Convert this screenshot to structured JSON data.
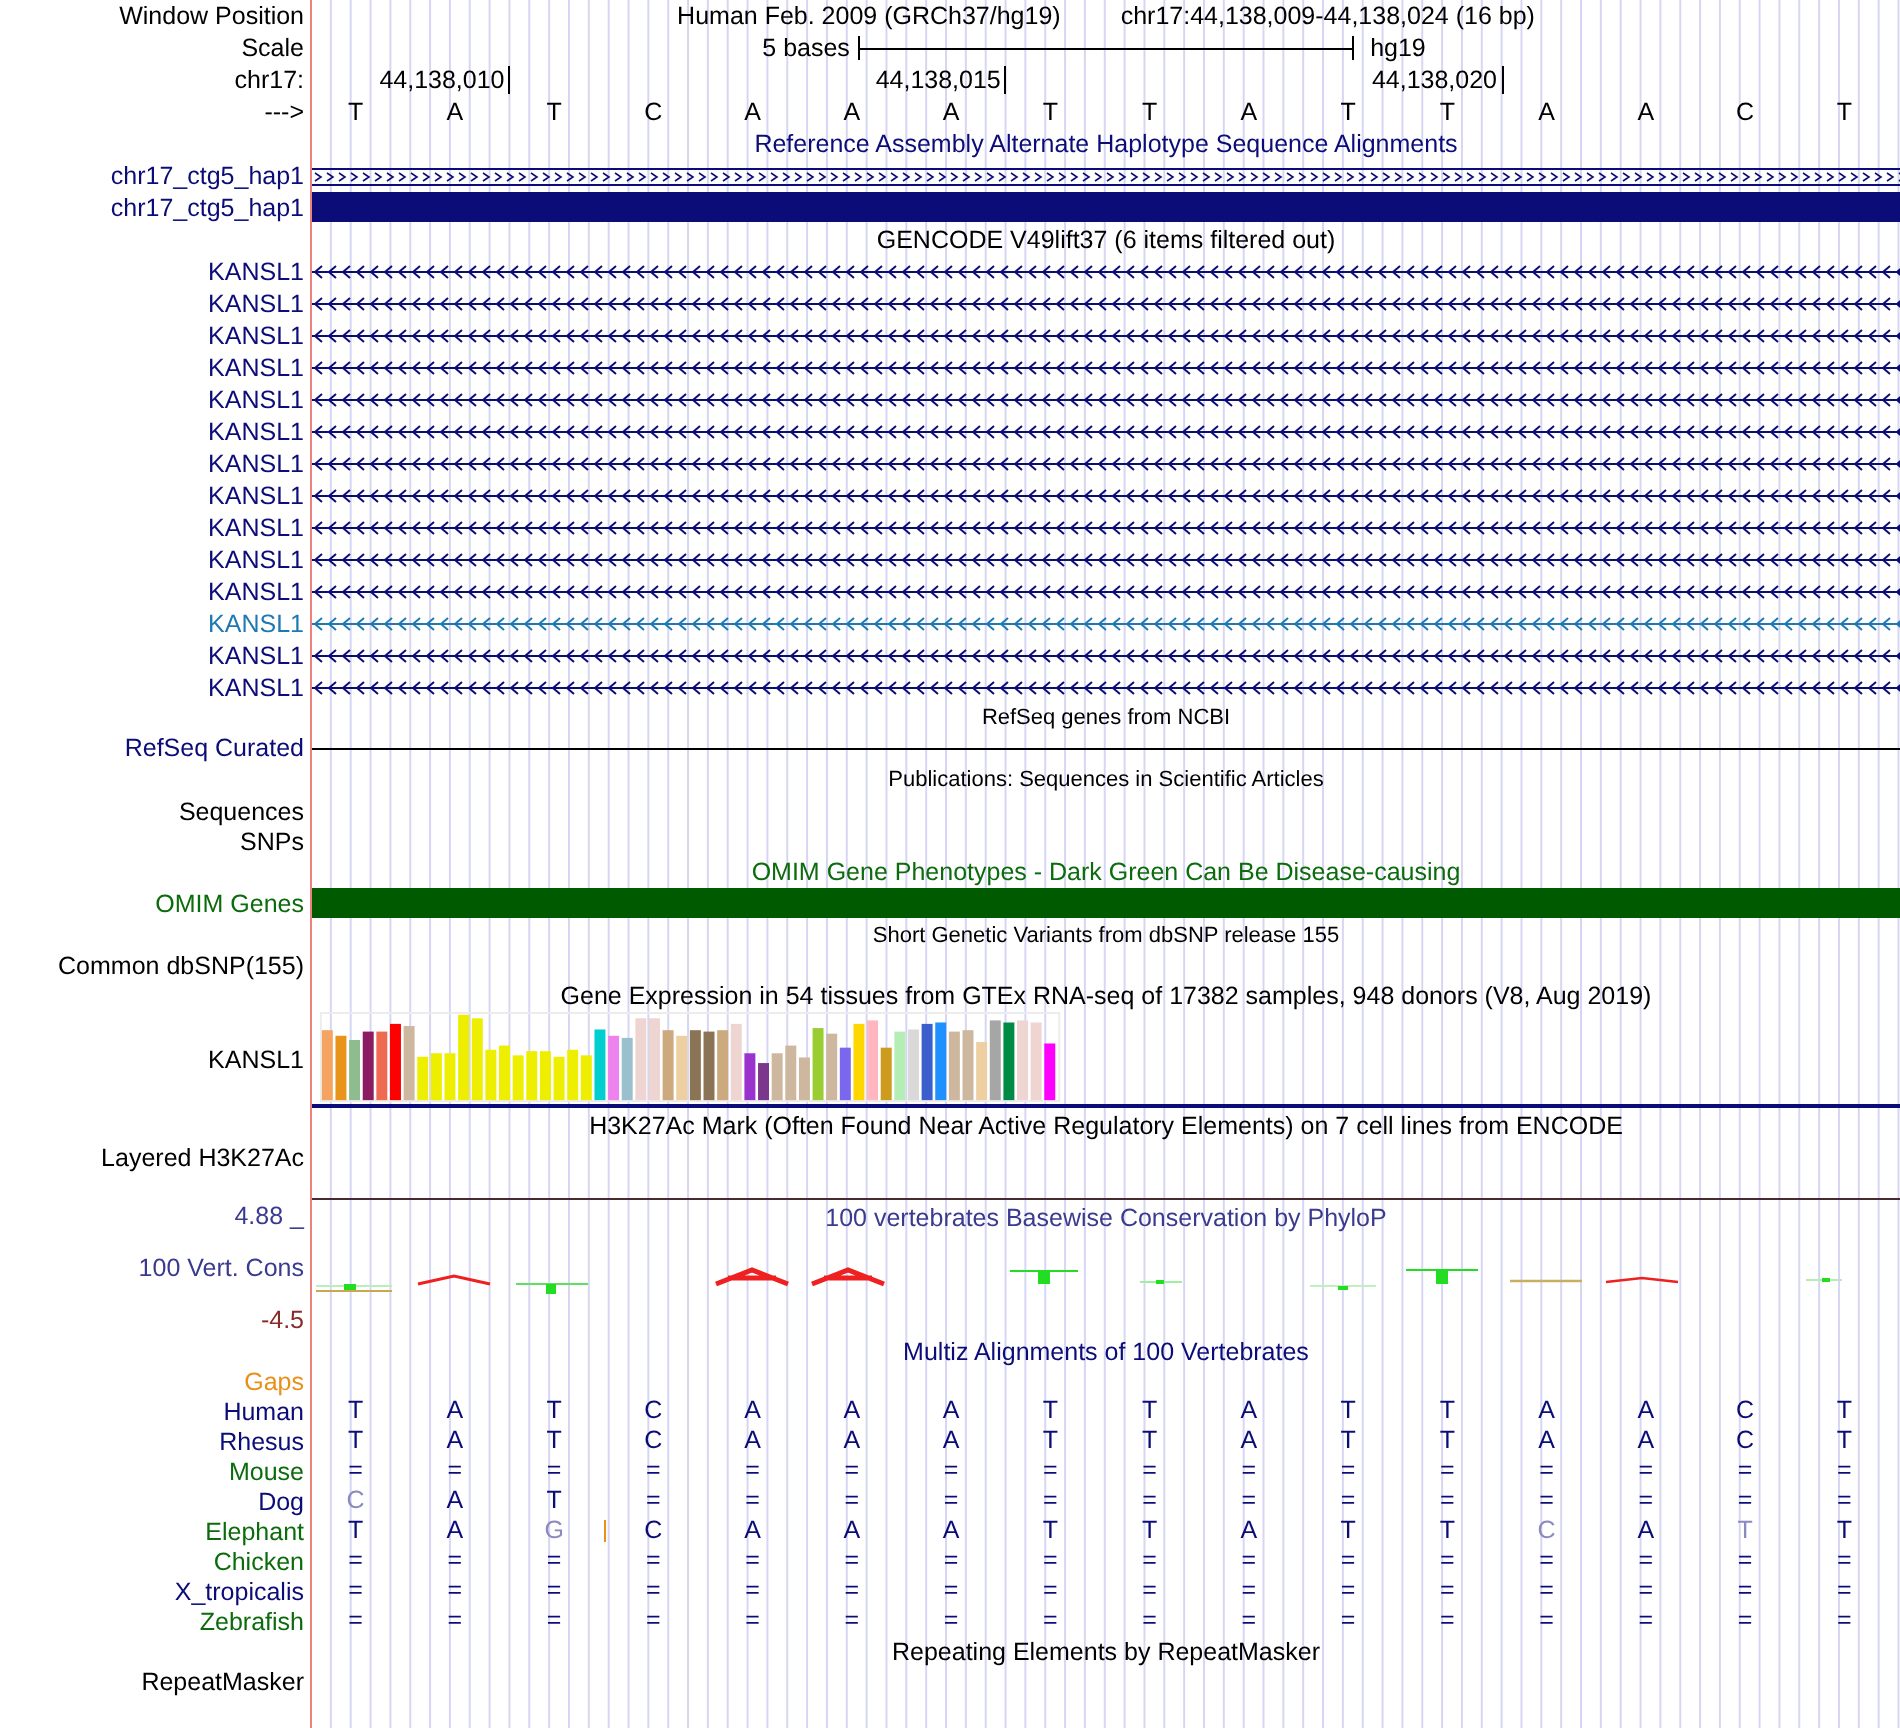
{
  "header": {
    "label": "Window Position",
    "assembly": "Human Feb. 2009 (GRCh37/hg19)",
    "range": "chr17:44,138,009-44,138,024 (16 bp)"
  },
  "scale": {
    "label": "Scale",
    "span": "5 bases",
    "db": "hg19"
  },
  "ruler": {
    "label": "chr17:",
    "ticks": [
      "44,138,010",
      "44,138,015",
      "44,138,020"
    ],
    "strand": "--->",
    "bases": [
      "T",
      "A",
      "T",
      "C",
      "A",
      "A",
      "A",
      "T",
      "T",
      "A",
      "T",
      "T",
      "A",
      "A",
      "C",
      "T"
    ]
  },
  "alt_haplotypes": {
    "title": "Reference Assembly Alternate Haplotype Sequence Alignments",
    "items": [
      {
        "label": "chr17_ctg5_hap1",
        "kind": "chevrons"
      },
      {
        "label": "chr17_ctg5_hap1",
        "kind": "solid"
      }
    ]
  },
  "gencode": {
    "title": "GENCODE V49lift37 (6 items filtered out)",
    "genes": [
      {
        "name": "KANSL1",
        "color": "#0c0c78"
      },
      {
        "name": "KANSL1",
        "color": "#0c0c78"
      },
      {
        "name": "KANSL1",
        "color": "#0c0c78"
      },
      {
        "name": "KANSL1",
        "color": "#0c0c78"
      },
      {
        "name": "KANSL1",
        "color": "#0c0c78"
      },
      {
        "name": "KANSL1",
        "color": "#0c0c78"
      },
      {
        "name": "KANSL1",
        "color": "#0c0c78"
      },
      {
        "name": "KANSL1",
        "color": "#0c0c78"
      },
      {
        "name": "KANSL1",
        "color": "#0c0c78"
      },
      {
        "name": "KANSL1",
        "color": "#0c0c78"
      },
      {
        "name": "KANSL1",
        "color": "#0c0c78"
      },
      {
        "name": "KANSL1",
        "color": "#1f78b4"
      },
      {
        "name": "KANSL1",
        "color": "#0c0c78"
      },
      {
        "name": "KANSL1",
        "color": "#0c0c78"
      }
    ]
  },
  "refseq": {
    "title": "RefSeq genes from NCBI",
    "label": "RefSeq Curated"
  },
  "publications": {
    "title": "Publications: Sequences in Scientific Articles",
    "labels": [
      "Sequences",
      "SNPs"
    ]
  },
  "omim": {
    "title": "OMIM Gene Phenotypes - Dark Green Can Be Disease-causing",
    "label": "OMIM Genes"
  },
  "dbsnp": {
    "title": "Short Genetic Variants from dbSNP release 155",
    "label": "Common dbSNP(155)"
  },
  "gtex": {
    "title": "Gene Expression in 54 tissues from GTEx RNA-seq of 17382 samples, 948 donors (V8, Aug 2019)",
    "label": "KANSL1"
  },
  "h3k27ac": {
    "title": "H3K27Ac Mark (Often Found Near Active Regulatory Elements) on 7 cell lines from ENCODE",
    "label": "Layered H3K27Ac"
  },
  "conservation": {
    "title": "100 vertebrates Basewise Conservation by PhyloP",
    "label": "100 Vert. Cons",
    "max": "4.88 _",
    "min": "-4.5"
  },
  "multiz": {
    "title": "Multiz Alignments of 100 Vertebrates",
    "gaps_label": "Gaps",
    "species": [
      {
        "name": "Human",
        "color": "#0c0c78",
        "bases": [
          {
            "b": "T",
            "faded": false,
            "gap_after": false
          },
          {
            "b": "A",
            "faded": false,
            "gap_after": false
          },
          {
            "b": "T",
            "faded": false,
            "gap_after": false
          },
          {
            "b": "C",
            "faded": false,
            "gap_after": false
          },
          {
            "b": "A",
            "faded": false,
            "gap_after": false
          },
          {
            "b": "A",
            "faded": false,
            "gap_after": false
          },
          {
            "b": "A",
            "faded": false,
            "gap_after": false
          },
          {
            "b": "T",
            "faded": false,
            "gap_after": false
          },
          {
            "b": "T",
            "faded": false,
            "gap_after": false
          },
          {
            "b": "A",
            "faded": false,
            "gap_after": false
          },
          {
            "b": "T",
            "faded": false,
            "gap_after": false
          },
          {
            "b": "T",
            "faded": false,
            "gap_after": false
          },
          {
            "b": "A",
            "faded": false,
            "gap_after": false
          },
          {
            "b": "A",
            "faded": false,
            "gap_after": false
          },
          {
            "b": "C",
            "faded": false,
            "gap_after": false
          },
          {
            "b": "T",
            "faded": false,
            "gap_after": false
          }
        ]
      },
      {
        "name": "Rhesus",
        "color": "#0c0c78",
        "bases": [
          {
            "b": "T",
            "faded": false,
            "gap_after": false
          },
          {
            "b": "A",
            "faded": false,
            "gap_after": false
          },
          {
            "b": "T",
            "faded": false,
            "gap_after": false
          },
          {
            "b": "C",
            "faded": false,
            "gap_after": false
          },
          {
            "b": "A",
            "faded": false,
            "gap_after": false
          },
          {
            "b": "A",
            "faded": false,
            "gap_after": false
          },
          {
            "b": "A",
            "faded": false,
            "gap_after": false
          },
          {
            "b": "T",
            "faded": false,
            "gap_after": false
          },
          {
            "b": "T",
            "faded": false,
            "gap_after": false
          },
          {
            "b": "A",
            "faded": false,
            "gap_after": false
          },
          {
            "b": "T",
            "faded": false,
            "gap_after": false
          },
          {
            "b": "T",
            "faded": false,
            "gap_after": false
          },
          {
            "b": "A",
            "faded": false,
            "gap_after": false
          },
          {
            "b": "A",
            "faded": false,
            "gap_after": false
          },
          {
            "b": "C",
            "faded": false,
            "gap_after": false
          },
          {
            "b": "T",
            "faded": false,
            "gap_after": false
          }
        ]
      },
      {
        "name": "Mouse",
        "color": "#0c6b0c",
        "bases": [
          {
            "b": "=",
            "faded": false,
            "gap_after": false
          },
          {
            "b": "=",
            "faded": false,
            "gap_after": false
          },
          {
            "b": "=",
            "faded": false,
            "gap_after": false
          },
          {
            "b": "=",
            "faded": false,
            "gap_after": false
          },
          {
            "b": "=",
            "faded": false,
            "gap_after": false
          },
          {
            "b": "=",
            "faded": false,
            "gap_after": false
          },
          {
            "b": "=",
            "faded": false,
            "gap_after": false
          },
          {
            "b": "=",
            "faded": false,
            "gap_after": false
          },
          {
            "b": "=",
            "faded": false,
            "gap_after": false
          },
          {
            "b": "=",
            "faded": false,
            "gap_after": false
          },
          {
            "b": "=",
            "faded": false,
            "gap_after": false
          },
          {
            "b": "=",
            "faded": false,
            "gap_after": false
          },
          {
            "b": "=",
            "faded": false,
            "gap_after": false
          },
          {
            "b": "=",
            "faded": false,
            "gap_after": false
          },
          {
            "b": "=",
            "faded": false,
            "gap_after": false
          },
          {
            "b": "=",
            "faded": false,
            "gap_after": false
          }
        ]
      },
      {
        "name": "Dog",
        "color": "#0c0c78",
        "bases": [
          {
            "b": "C",
            "faded": true,
            "gap_after": false
          },
          {
            "b": "A",
            "faded": false,
            "gap_after": false
          },
          {
            "b": "T",
            "faded": false,
            "gap_after": false
          },
          {
            "b": "=",
            "faded": false,
            "gap_after": false
          },
          {
            "b": "=",
            "faded": false,
            "gap_after": false
          },
          {
            "b": "=",
            "faded": false,
            "gap_after": false
          },
          {
            "b": "=",
            "faded": false,
            "gap_after": false
          },
          {
            "b": "=",
            "faded": false,
            "gap_after": false
          },
          {
            "b": "=",
            "faded": false,
            "gap_after": false
          },
          {
            "b": "=",
            "faded": false,
            "gap_after": false
          },
          {
            "b": "=",
            "faded": false,
            "gap_after": false
          },
          {
            "b": "=",
            "faded": false,
            "gap_after": false
          },
          {
            "b": "=",
            "faded": false,
            "gap_after": false
          },
          {
            "b": "=",
            "faded": false,
            "gap_after": false
          },
          {
            "b": "=",
            "faded": false,
            "gap_after": false
          },
          {
            "b": "=",
            "faded": false,
            "gap_after": false
          }
        ]
      },
      {
        "name": "Elephant",
        "color": "#0c6b0c",
        "bases": [
          {
            "b": "T",
            "faded": false,
            "gap_after": false
          },
          {
            "b": "A",
            "faded": false,
            "gap_after": false
          },
          {
            "b": "G",
            "faded": true,
            "gap_after": true
          },
          {
            "b": "C",
            "faded": false,
            "gap_after": false
          },
          {
            "b": "A",
            "faded": false,
            "gap_after": false
          },
          {
            "b": "A",
            "faded": false,
            "gap_after": false
          },
          {
            "b": "A",
            "faded": false,
            "gap_after": false
          },
          {
            "b": "T",
            "faded": false,
            "gap_after": false
          },
          {
            "b": "T",
            "faded": false,
            "gap_after": false
          },
          {
            "b": "A",
            "faded": false,
            "gap_after": false
          },
          {
            "b": "T",
            "faded": false,
            "gap_after": false
          },
          {
            "b": "T",
            "faded": false,
            "gap_after": false
          },
          {
            "b": "C",
            "faded": true,
            "gap_after": false
          },
          {
            "b": "A",
            "faded": false,
            "gap_after": false
          },
          {
            "b": "T",
            "faded": true,
            "gap_after": false
          },
          {
            "b": "T",
            "faded": false,
            "gap_after": false
          }
        ]
      },
      {
        "name": "Chicken",
        "color": "#0c6b0c",
        "bases": [
          {
            "b": "=",
            "faded": false,
            "gap_after": false
          },
          {
            "b": "=",
            "faded": false,
            "gap_after": false
          },
          {
            "b": "=",
            "faded": false,
            "gap_after": false
          },
          {
            "b": "=",
            "faded": false,
            "gap_after": false
          },
          {
            "b": "=",
            "faded": false,
            "gap_after": false
          },
          {
            "b": "=",
            "faded": false,
            "gap_after": false
          },
          {
            "b": "=",
            "faded": false,
            "gap_after": false
          },
          {
            "b": "=",
            "faded": false,
            "gap_after": false
          },
          {
            "b": "=",
            "faded": false,
            "gap_after": false
          },
          {
            "b": "=",
            "faded": false,
            "gap_after": false
          },
          {
            "b": "=",
            "faded": false,
            "gap_after": false
          },
          {
            "b": "=",
            "faded": false,
            "gap_after": false
          },
          {
            "b": "=",
            "faded": false,
            "gap_after": false
          },
          {
            "b": "=",
            "faded": false,
            "gap_after": false
          },
          {
            "b": "=",
            "faded": false,
            "gap_after": false
          },
          {
            "b": "=",
            "faded": false,
            "gap_after": false
          }
        ]
      },
      {
        "name": "X_tropicalis",
        "color": "#0c0c78",
        "bases": [
          {
            "b": "=",
            "faded": false,
            "gap_after": false
          },
          {
            "b": "=",
            "faded": false,
            "gap_after": false
          },
          {
            "b": "=",
            "faded": false,
            "gap_after": false
          },
          {
            "b": "=",
            "faded": false,
            "gap_after": false
          },
          {
            "b": "=",
            "faded": false,
            "gap_after": false
          },
          {
            "b": "=",
            "faded": false,
            "gap_after": false
          },
          {
            "b": "=",
            "faded": false,
            "gap_after": false
          },
          {
            "b": "=",
            "faded": false,
            "gap_after": false
          },
          {
            "b": "=",
            "faded": false,
            "gap_after": false
          },
          {
            "b": "=",
            "faded": false,
            "gap_after": false
          },
          {
            "b": "=",
            "faded": false,
            "gap_after": false
          },
          {
            "b": "=",
            "faded": false,
            "gap_after": false
          },
          {
            "b": "=",
            "faded": false,
            "gap_after": false
          },
          {
            "b": "=",
            "faded": false,
            "gap_after": false
          },
          {
            "b": "=",
            "faded": false,
            "gap_after": false
          },
          {
            "b": "=",
            "faded": false,
            "gap_after": false
          }
        ]
      },
      {
        "name": "Zebrafish",
        "color": "#0c6b0c",
        "bases": [
          {
            "b": "=",
            "faded": false,
            "gap_after": false
          },
          {
            "b": "=",
            "faded": false,
            "gap_after": false
          },
          {
            "b": "=",
            "faded": false,
            "gap_after": false
          },
          {
            "b": "=",
            "faded": false,
            "gap_after": false
          },
          {
            "b": "=",
            "faded": false,
            "gap_after": false
          },
          {
            "b": "=",
            "faded": false,
            "gap_after": false
          },
          {
            "b": "=",
            "faded": false,
            "gap_after": false
          },
          {
            "b": "=",
            "faded": false,
            "gap_after": false
          },
          {
            "b": "=",
            "faded": false,
            "gap_after": false
          },
          {
            "b": "=",
            "faded": false,
            "gap_after": false
          },
          {
            "b": "=",
            "faded": false,
            "gap_after": false
          },
          {
            "b": "=",
            "faded": false,
            "gap_after": false
          },
          {
            "b": "=",
            "faded": false,
            "gap_after": false
          },
          {
            "b": "=",
            "faded": false,
            "gap_after": false
          },
          {
            "b": "=",
            "faded": false,
            "gap_after": false
          },
          {
            "b": "=",
            "faded": false,
            "gap_after": false
          }
        ]
      }
    ]
  },
  "repeatmasker": {
    "title": "Repeating Elements by RepeatMasker",
    "label": "RepeatMasker"
  }
}
